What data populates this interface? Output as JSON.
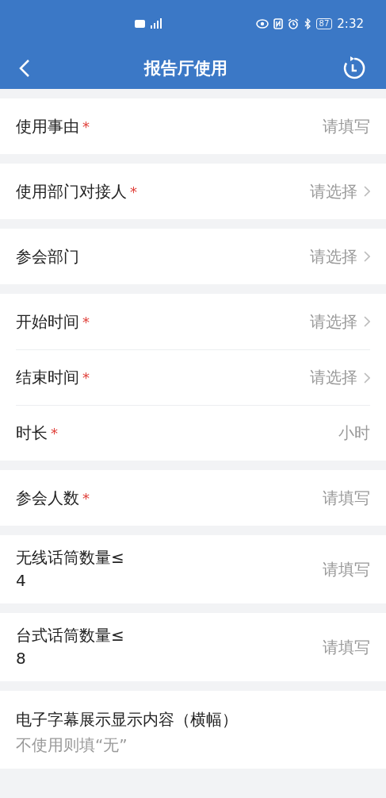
{
  "status_bar": {
    "battery": "87",
    "time": "2:32"
  },
  "nav": {
    "title": "报告厅使用"
  },
  "groups": [
    {
      "rows": [
        {
          "kind": "input",
          "label": "使用事由",
          "required_mark": "*",
          "placeholder": "请填写"
        }
      ]
    },
    {
      "rows": [
        {
          "kind": "select",
          "label": "使用部门对接人",
          "required_mark": "*",
          "placeholder": "请选择"
        }
      ]
    },
    {
      "rows": [
        {
          "kind": "select",
          "label": "参会部门",
          "placeholder": "请选择"
        }
      ]
    },
    {
      "rows": [
        {
          "kind": "select",
          "label": "开始时间",
          "required_mark": "*",
          "placeholder": "请选择"
        },
        {
          "kind": "select",
          "label": "结束时间",
          "required_mark": "*",
          "placeholder": "请选择"
        },
        {
          "kind": "unit",
          "label": "时长",
          "required_mark": "*",
          "placeholder": "小时"
        }
      ]
    },
    {
      "rows": [
        {
          "kind": "input",
          "label": "参会人数",
          "required_mark": "*",
          "placeholder": "请填写"
        }
      ]
    },
    {
      "rows": [
        {
          "kind": "input",
          "label": "无线话筒数量≤\n4",
          "placeholder": "请填写"
        }
      ]
    },
    {
      "rows": [
        {
          "kind": "input",
          "label": "台式话筒数量≤\n8",
          "placeholder": "请填写"
        }
      ]
    },
    {
      "rows": [
        {
          "kind": "textarea",
          "label": "电子字幕展示显示内容（横幅）",
          "placeholder": "不使用则填“无”"
        }
      ]
    }
  ]
}
